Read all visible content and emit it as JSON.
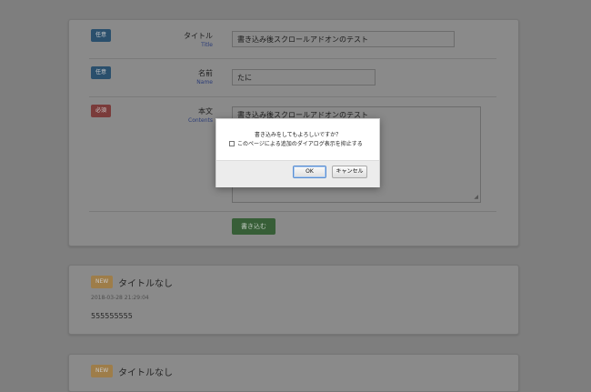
{
  "form": {
    "title_field": {
      "badge": "任意",
      "label": "タイトル",
      "sublabel": "Title",
      "value": "書き込み後スクロールアドオンのテスト"
    },
    "name_field": {
      "badge": "任意",
      "label": "名前",
      "sublabel": "Name",
      "value": "たに"
    },
    "content_field": {
      "badge": "必須",
      "label": "本文",
      "sublabel": "Contents",
      "value": "書き込み後スクロールアドオンのテスト"
    },
    "submit_label": "書き込む"
  },
  "posts": [
    {
      "badge": "NEW",
      "title": "タイトルなし",
      "date": "2018-03-28 21:29:04",
      "body": "555555555"
    },
    {
      "badge": "NEW",
      "title": "タイトルなし"
    }
  ],
  "dialog": {
    "message": "書き込みをしてもよろしいですか？",
    "checkbox_label": "このページによる追加のダイアログ表示を抑止する",
    "ok_label": "OK",
    "cancel_label": "キャンセル"
  }
}
